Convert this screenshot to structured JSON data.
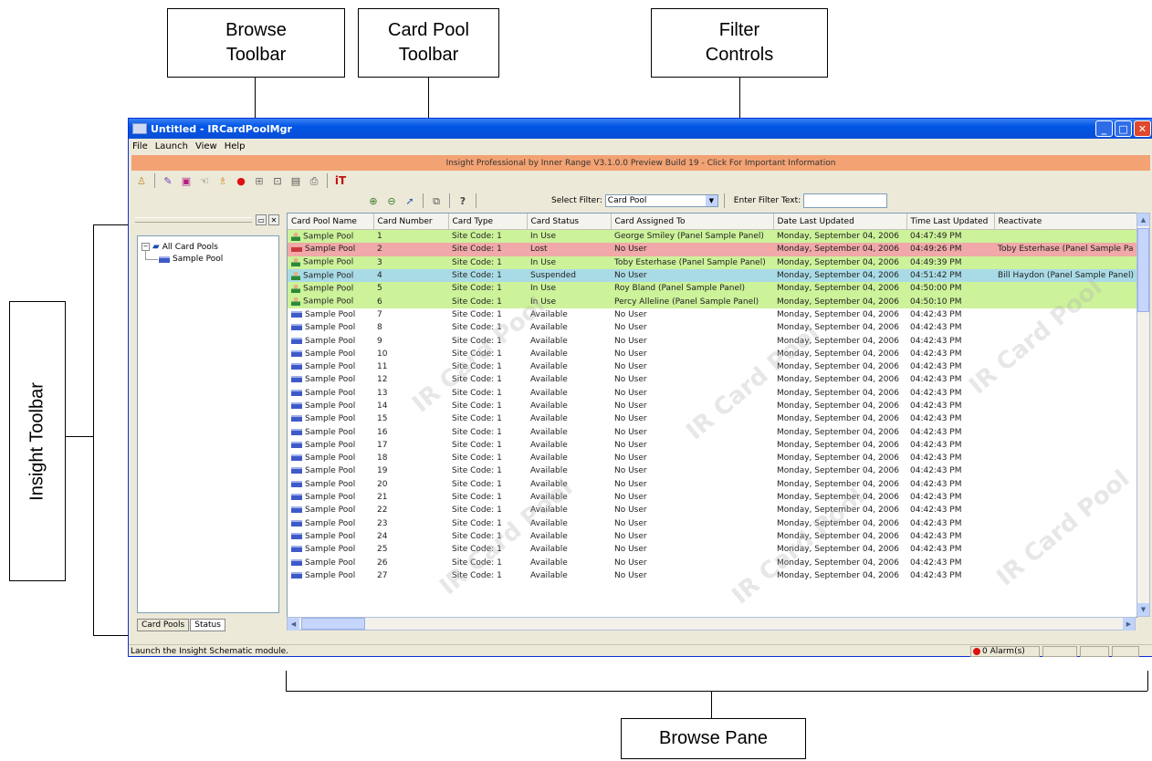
{
  "callouts": {
    "browse_toolbar": [
      "Browse",
      "Toolbar"
    ],
    "card_pool_toolbar": [
      "Card Pool",
      "Toolbar"
    ],
    "filter_controls": [
      "Filter",
      "Controls"
    ],
    "insight_toolbar": "Insight Toolbar",
    "browse_pane": "Browse Pane"
  },
  "window": {
    "title": "Untitled - IRCardPoolMgr",
    "menu": [
      "File",
      "Launch",
      "View",
      "Help"
    ],
    "banner": "Insight Professional by Inner Range V3.1.0.0 Preview Build 19 - Click For Important Information",
    "select_filter_label": "Select Filter:",
    "select_filter_value": "Card Pool",
    "filter_text_label": "Enter Filter Text:",
    "filter_text_value": ""
  },
  "insight_toolbar": {
    "icons": [
      "user-icon",
      "pen-icon",
      "monitor-icon",
      "hand-icon",
      "figure-icon",
      "alarm-icon",
      "schematic-icon",
      "terminal-icon",
      "card-reader-icon",
      "printer-icon",
      "inner-range-logo-icon"
    ]
  },
  "card_pool_toolbar": {
    "icons": [
      "add-cards-icon",
      "remove-cards-icon",
      "edit-card-icon",
      "copy-icon",
      "help-icon"
    ]
  },
  "tree": {
    "root": "All Card Pools",
    "child": "Sample Pool"
  },
  "left_tabs": [
    "Card Pools",
    "Status"
  ],
  "grid": {
    "columns": [
      "Card Pool Name",
      "Card Number",
      "Card Type",
      "Card Status",
      "Card Assigned To",
      "Date Last Updated",
      "Time Last Updated",
      "Reactivate"
    ],
    "rows": [
      [
        "Sample Pool",
        "1",
        "Site Code: 1",
        "In Use",
        "George Smiley (Panel Sample Panel)",
        "Monday, September 04, 2006",
        "04:47:49 PM",
        ""
      ],
      [
        "Sample Pool",
        "2",
        "Site Code: 1",
        "Lost",
        "No User",
        "Monday, September 04, 2006",
        "04:49:26 PM",
        "Toby Esterhase (Panel Sample Pa"
      ],
      [
        "Sample Pool",
        "3",
        "Site Code: 1",
        "In Use",
        "Toby Esterhase (Panel Sample Panel)",
        "Monday, September 04, 2006",
        "04:49:39 PM",
        ""
      ],
      [
        "Sample Pool",
        "4",
        "Site Code: 1",
        "Suspended",
        "No User",
        "Monday, September 04, 2006",
        "04:51:42 PM",
        "Bill Haydon (Panel Sample Panel)"
      ],
      [
        "Sample Pool",
        "5",
        "Site Code: 1",
        "In Use",
        "Roy Bland (Panel Sample Panel)",
        "Monday, September 04, 2006",
        "04:50:00 PM",
        ""
      ],
      [
        "Sample Pool",
        "6",
        "Site Code: 1",
        "In Use",
        "Percy Alleline (Panel Sample Panel)",
        "Monday, September 04, 2006",
        "04:50:10 PM",
        ""
      ],
      [
        "Sample Pool",
        "7",
        "Site Code: 1",
        "Available",
        "No User",
        "Monday, September 04, 2006",
        "04:42:43 PM",
        ""
      ],
      [
        "Sample Pool",
        "8",
        "Site Code: 1",
        "Available",
        "No User",
        "Monday, September 04, 2006",
        "04:42:43 PM",
        ""
      ],
      [
        "Sample Pool",
        "9",
        "Site Code: 1",
        "Available",
        "No User",
        "Monday, September 04, 2006",
        "04:42:43 PM",
        ""
      ],
      [
        "Sample Pool",
        "10",
        "Site Code: 1",
        "Available",
        "No User",
        "Monday, September 04, 2006",
        "04:42:43 PM",
        ""
      ],
      [
        "Sample Pool",
        "11",
        "Site Code: 1",
        "Available",
        "No User",
        "Monday, September 04, 2006",
        "04:42:43 PM",
        ""
      ],
      [
        "Sample Pool",
        "12",
        "Site Code: 1",
        "Available",
        "No User",
        "Monday, September 04, 2006",
        "04:42:43 PM",
        ""
      ],
      [
        "Sample Pool",
        "13",
        "Site Code: 1",
        "Available",
        "No User",
        "Monday, September 04, 2006",
        "04:42:43 PM",
        ""
      ],
      [
        "Sample Pool",
        "14",
        "Site Code: 1",
        "Available",
        "No User",
        "Monday, September 04, 2006",
        "04:42:43 PM",
        ""
      ],
      [
        "Sample Pool",
        "15",
        "Site Code: 1",
        "Available",
        "No User",
        "Monday, September 04, 2006",
        "04:42:43 PM",
        ""
      ],
      [
        "Sample Pool",
        "16",
        "Site Code: 1",
        "Available",
        "No User",
        "Monday, September 04, 2006",
        "04:42:43 PM",
        ""
      ],
      [
        "Sample Pool",
        "17",
        "Site Code: 1",
        "Available",
        "No User",
        "Monday, September 04, 2006",
        "04:42:43 PM",
        ""
      ],
      [
        "Sample Pool",
        "18",
        "Site Code: 1",
        "Available",
        "No User",
        "Monday, September 04, 2006",
        "04:42:43 PM",
        ""
      ],
      [
        "Sample Pool",
        "19",
        "Site Code: 1",
        "Available",
        "No User",
        "Monday, September 04, 2006",
        "04:42:43 PM",
        ""
      ],
      [
        "Sample Pool",
        "20",
        "Site Code: 1",
        "Available",
        "No User",
        "Monday, September 04, 2006",
        "04:42:43 PM",
        ""
      ],
      [
        "Sample Pool",
        "21",
        "Site Code: 1",
        "Available",
        "No User",
        "Monday, September 04, 2006",
        "04:42:43 PM",
        ""
      ],
      [
        "Sample Pool",
        "22",
        "Site Code: 1",
        "Available",
        "No User",
        "Monday, September 04, 2006",
        "04:42:43 PM",
        ""
      ],
      [
        "Sample Pool",
        "23",
        "Site Code: 1",
        "Available",
        "No User",
        "Monday, September 04, 2006",
        "04:42:43 PM",
        ""
      ],
      [
        "Sample Pool",
        "24",
        "Site Code: 1",
        "Available",
        "No User",
        "Monday, September 04, 2006",
        "04:42:43 PM",
        ""
      ],
      [
        "Sample Pool",
        "25",
        "Site Code: 1",
        "Available",
        "No User",
        "Monday, September 04, 2006",
        "04:42:43 PM",
        ""
      ],
      [
        "Sample Pool",
        "26",
        "Site Code: 1",
        "Available",
        "No User",
        "Monday, September 04, 2006",
        "04:42:43 PM",
        ""
      ],
      [
        "Sample Pool",
        "27",
        "Site Code: 1",
        "Available",
        "No User",
        "Monday, September 04, 2006",
        "04:42:43 PM",
        ""
      ]
    ],
    "row_colors": {
      "In Use": "#ccf29a",
      "Lost": "#f0a8a8",
      "Suspended": "#a9dbe6",
      "Available": "#ffffff"
    },
    "watermark": "IR Card Pool"
  },
  "status": {
    "text": "Launch the Insight Schematic module.",
    "alarms": "0 Alarm(s)"
  },
  "colors": {
    "banner": "#f3a273",
    "titlebar": "#0055e5"
  }
}
